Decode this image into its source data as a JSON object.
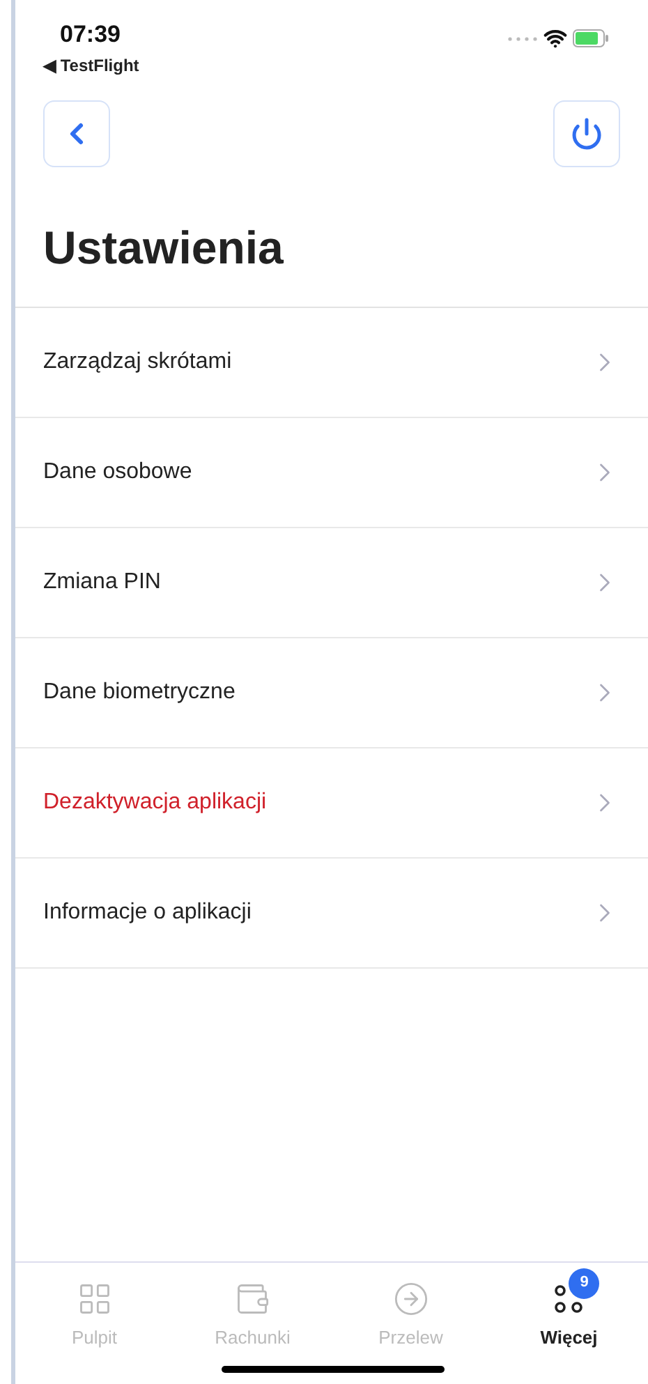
{
  "status_bar": {
    "time": "07:39",
    "back_app": "◀ TestFlight"
  },
  "title": "Ustawienia",
  "items": [
    {
      "label": "Zarządzaj skrótami",
      "kind": "normal"
    },
    {
      "label": "Dane osobowe",
      "kind": "normal"
    },
    {
      "label": "Zmiana PIN",
      "kind": "normal"
    },
    {
      "label": "Dane biometryczne",
      "kind": "normal"
    },
    {
      "label": "Dezaktywacja aplikacji",
      "kind": "danger"
    },
    {
      "label": "Informacje o aplikacji",
      "kind": "normal"
    }
  ],
  "tab_bar": [
    {
      "label": "Pulpit",
      "kind": "grid",
      "selected": false
    },
    {
      "label": "Rachunki",
      "kind": "wallet",
      "selected": false
    },
    {
      "label": "Przelew",
      "kind": "arrow",
      "selected": false
    },
    {
      "label": "Więcej",
      "kind": "more",
      "selected": true,
      "badge": "9"
    }
  ]
}
